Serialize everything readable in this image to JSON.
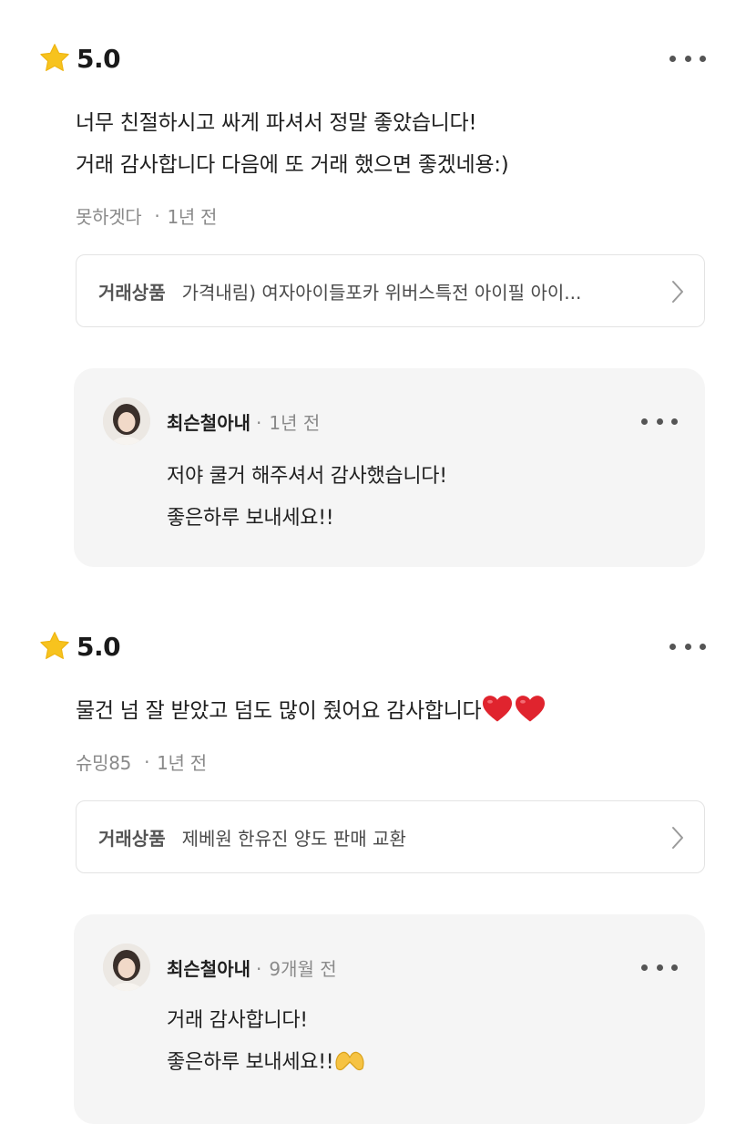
{
  "reviews": [
    {
      "rating": "5.0",
      "text_lines": [
        "너무 친절하시고 싸게 파셔서 정말 좋았습니다!",
        "거래 감사합니다 다음에 또 거래 했으면 좋겠네용:)"
      ],
      "reviewer": "못하겟다",
      "time": "1년 전",
      "product_tag": "거래상품",
      "product_name": "가격내림) 여자아이들포카 위버스특전 아이필 아이...",
      "reply": {
        "name": "최슨철아내",
        "time": "1년 전",
        "lines": [
          "저야 쿨거 해주셔서 감사했습니다!",
          "좋은하루 보내세요!!"
        ]
      }
    },
    {
      "rating": "5.0",
      "text_lines": [
        "물건 넘 잘 받았고 덤도 많이 줬어요 감사합니다"
      ],
      "reviewer": "슈밍85",
      "time": "1년 전",
      "product_tag": "거래상품",
      "product_name": "제베원 한유진 양도 판매 교환",
      "reply": {
        "name": "최슨철아내",
        "time": "9개월 전",
        "lines": [
          "거래 감사합니다!",
          "좋은하루 보내세요!!"
        ]
      }
    }
  ],
  "icons": {
    "star": "star-icon",
    "more": "more-icon",
    "chevron": "chevron-right-icon",
    "heart": "heart-icon",
    "hands": "heart-hands-icon",
    "avatar": "avatar"
  },
  "colors": {
    "star": "#F7C31E",
    "heart": "#E0242E",
    "reply_bg": "#F5F5F5",
    "meta_text": "#8A8A8A"
  }
}
